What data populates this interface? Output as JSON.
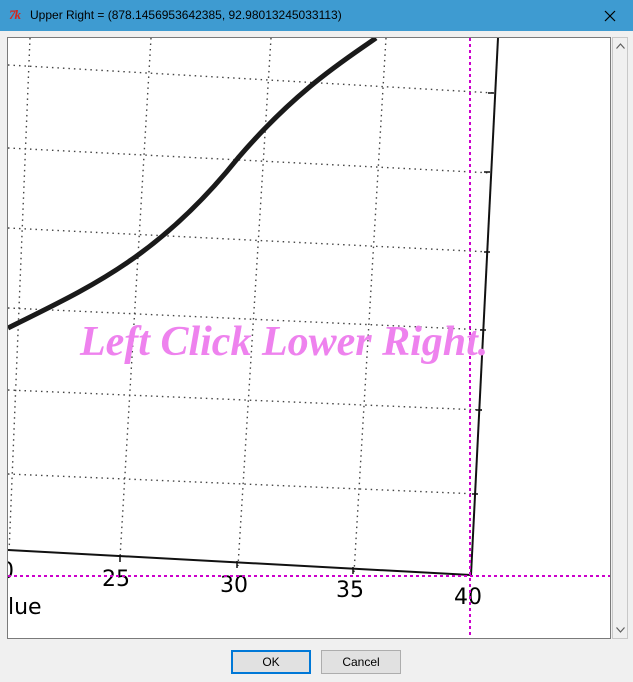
{
  "window": {
    "icon": "tk-feather-icon",
    "icon_text": "7k",
    "title": "Upper Right = (878.1456953642385, 92.98013245033113)",
    "close_icon": "close-icon"
  },
  "canvas": {
    "instruction": "Left Click Lower Right.",
    "instruction_color": "#ee82ee",
    "crosshair_color": "#cc00cc",
    "axis_label": "lue",
    "tick_labels": [
      "0",
      "25",
      "30",
      "35",
      "40"
    ]
  },
  "buttons": {
    "ok_label": "OK",
    "cancel_label": "Cancel"
  },
  "colors": {
    "titlebar": "#3e9bd1",
    "accent": "#0078d7"
  }
}
